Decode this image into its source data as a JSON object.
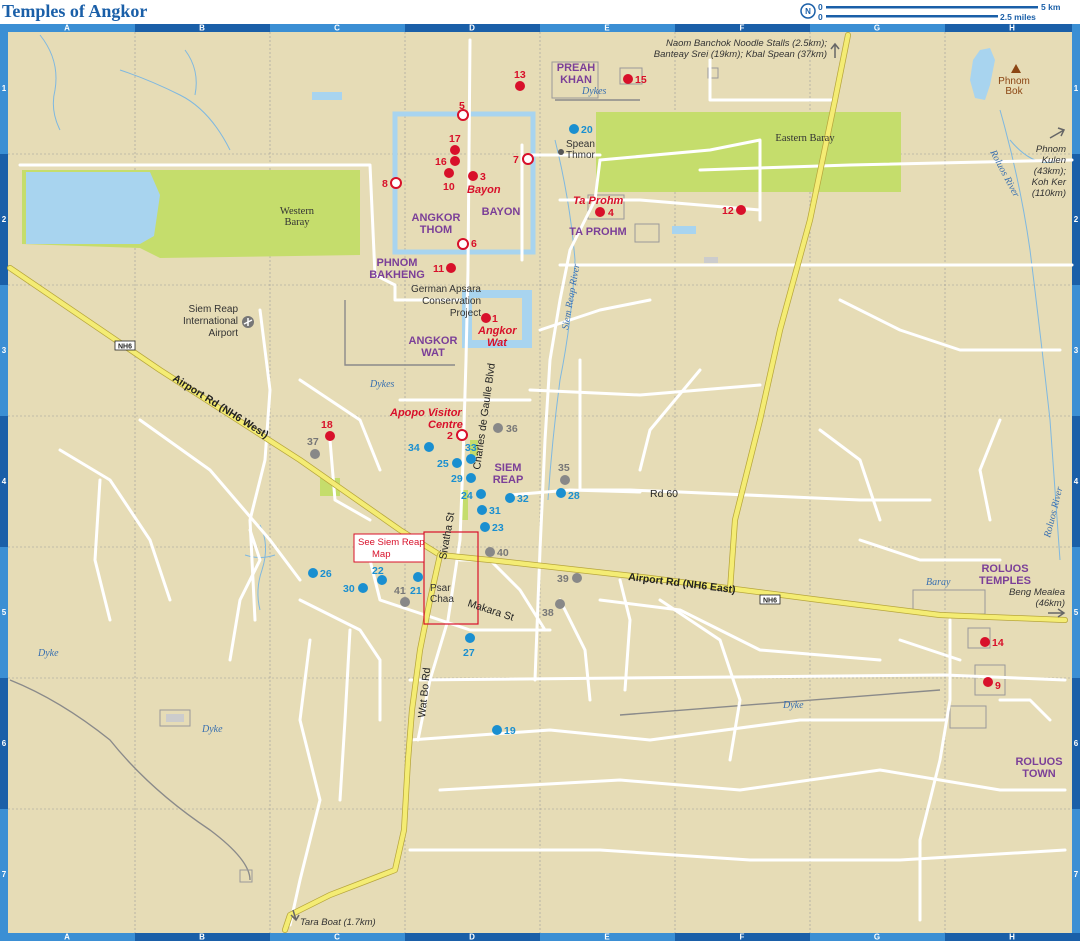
{
  "title": "Temples of Angkor",
  "scale": {
    "zero_a": "0",
    "zero_b": "0",
    "km": "5 km",
    "miles": "2.5 miles",
    "north": "N"
  },
  "grid": {
    "columns": [
      "A",
      "B",
      "C",
      "D",
      "E",
      "F",
      "G",
      "H"
    ],
    "rows": [
      "1",
      "2",
      "3",
      "4",
      "5",
      "6",
      "7"
    ]
  },
  "areas": {
    "preah_khan": [
      "PREAH",
      "KHAN"
    ],
    "angkor_thom": [
      "ANGKOR",
      "THOM"
    ],
    "bayon_area": "BAYON",
    "ta_prohm_area": "TA PROHM",
    "phnom_bakheng": [
      "PHNOM",
      "BAKHENG"
    ],
    "angkor_wat_area": [
      "ANGKOR",
      "WAT"
    ],
    "siem_reap": [
      "SIEM",
      "REAP"
    ],
    "roluos_temples": [
      "ROLUOS",
      "TEMPLES"
    ],
    "roluos_town": [
      "ROLUOS",
      "TOWN"
    ]
  },
  "sites": {
    "bayon": "Bayon",
    "ta_prohm": "Ta Prohm",
    "angkor_wat": [
      "Angkor",
      "Wat"
    ],
    "apopo": [
      "Apopo Visitor",
      "Centre"
    ]
  },
  "places": {
    "noodle_stalls": [
      "Naom Banchok Noodle Stalls (2.5km);",
      "Banteay Srei (19km); Kbal Spean (37km)"
    ],
    "phnom_bok": [
      "Phnom",
      "Bok"
    ],
    "phnom_kulen": [
      "Phnom",
      "Kulen",
      "(43km);",
      "Koh Ker",
      "(110km)"
    ],
    "spean_thmor": [
      "Spean",
      "Thmor"
    ],
    "airport": [
      "Siem Reap",
      "International",
      "Airport"
    ],
    "apsara": [
      "German Apsara",
      "Conservation",
      "Project"
    ],
    "beng_mealea": [
      "Beng Mealea",
      "(46km)"
    ],
    "tara_boat": "Tara Boat (1.7km)",
    "psar_chaa": [
      "Psar",
      "Chaa"
    ]
  },
  "water": {
    "western_baray": [
      "Western",
      "Baray"
    ],
    "eastern_baray": "Eastern Baray",
    "dykes_top": "Dykes",
    "dykes_mid": "Dykes",
    "baray": "Baray",
    "dyke_a": "Dyke",
    "dyke_b": "Dyke",
    "dyke_f": "Dyke",
    "siem_reap_river": "Siem Reap River",
    "roluos_river_top": "Roluos River",
    "roluos_river_bottom": "Roluos River"
  },
  "roads": {
    "airport_west": "Airport Rd (NH6 West)",
    "airport_east": "Airport Rd (NH6 East)",
    "nh6_west": "NH6",
    "nh6_east": "NH6",
    "charles": "Charles de Gaulle Blvd",
    "sivatha": "Sivatha St",
    "wat_bo": "Wat Bo Rd",
    "makara": "Makara St",
    "rd60": "Rd 60"
  },
  "callout": [
    "See Siem Reap",
    "Map"
  ],
  "markers": {
    "m1": "1",
    "m2": "2",
    "m3": "3",
    "m4": "4",
    "m5": "5",
    "m6": "6",
    "m7": "7",
    "m8": "8",
    "m9": "9",
    "m10": "10",
    "m11": "11",
    "m12": "12",
    "m13": "13",
    "m14": "14",
    "m15": "15",
    "m16": "16",
    "m17": "17",
    "m18": "18",
    "m19": "19",
    "m20": "20",
    "m21": "21",
    "m22": "22",
    "m23": "23",
    "m24": "24",
    "m25": "25",
    "m26": "26",
    "m27": "27",
    "m28": "28",
    "m29": "29",
    "m30": "30",
    "m31": "31",
    "m32": "32",
    "m33": "33",
    "m34": "34",
    "m35": "35",
    "m36": "36",
    "m37": "37",
    "m38": "38",
    "m39": "39",
    "m40": "40",
    "m41": "41"
  },
  "colors": {
    "land": "#e6dcb6",
    "water": "#a8d4ef",
    "green": "#c5dd6c",
    "road": "#ffffff",
    "highway": "#f4ec74",
    "frame": "#1a5fa8",
    "red": "#d8102a",
    "blue": "#1a8fd0",
    "purple": "#7b3f98"
  }
}
